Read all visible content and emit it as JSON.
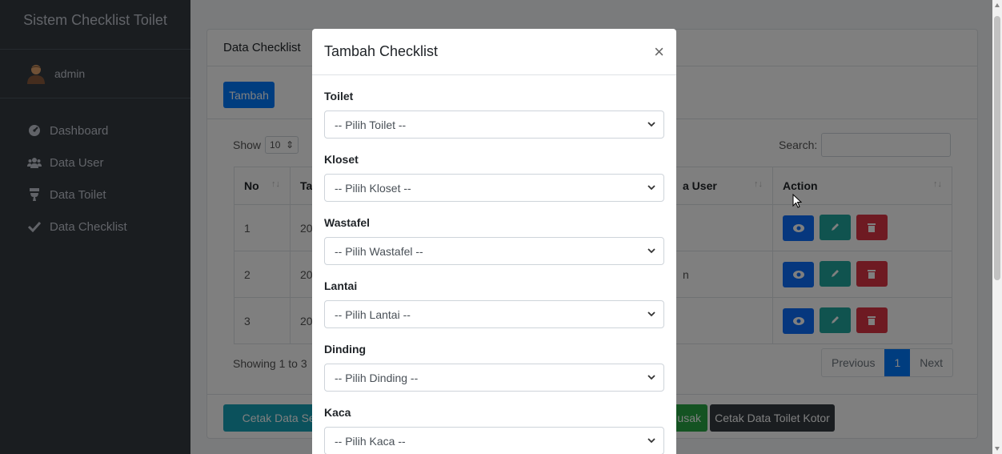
{
  "sidebar": {
    "brand": "Sistem Checklist Toilet",
    "user": "admin",
    "items": [
      {
        "label": "Dashboard",
        "icon": "dashboard-icon"
      },
      {
        "label": "Data User",
        "icon": "users-icon"
      },
      {
        "label": "Data Toilet",
        "icon": "toilet-icon"
      },
      {
        "label": "Data Checklist",
        "icon": "check-icon"
      }
    ]
  },
  "card": {
    "title": "Data Checklist",
    "add_label": "Tambah",
    "show_label": "Show",
    "show_value": "10",
    "search_label": "Search:",
    "columns": [
      "No",
      "Ta",
      "a User",
      "Action"
    ],
    "rows": [
      {
        "no": "1",
        "tanggal": "20",
        "user": ""
      },
      {
        "no": "2",
        "tanggal": "20",
        "user": "n"
      },
      {
        "no": "3",
        "tanggal": "20",
        "user": ""
      }
    ],
    "showing": "Showing 1 to 3",
    "pager": {
      "previous": "Previous",
      "page": "1",
      "next": "Next"
    },
    "footer_buttons": {
      "cetak_semua": "Cetak Data Sem",
      "cetak_rusak": "usak",
      "cetak_kotor": "Cetak Data Toilet Kotor"
    }
  },
  "modal": {
    "title": "Tambah Checklist",
    "close": "×",
    "fields": [
      {
        "label": "Toilet",
        "placeholder": "-- Pilih Toilet --"
      },
      {
        "label": "Kloset",
        "placeholder": "-- Pilih Kloset --"
      },
      {
        "label": "Wastafel",
        "placeholder": "-- Pilih Wastafel --"
      },
      {
        "label": "Lantai",
        "placeholder": "-- Pilih Lantai --"
      },
      {
        "label": "Dinding",
        "placeholder": "-- Pilih Dinding --"
      },
      {
        "label": "Kaca",
        "placeholder": "-- Pilih Kaca --"
      }
    ]
  },
  "colors": {
    "sidebar": "#343a40",
    "primary": "#007bff",
    "info": "#17a2b8",
    "teal": "#20a69e",
    "danger": "#dc3545",
    "success": "#28a745",
    "dark": "#343a40"
  }
}
